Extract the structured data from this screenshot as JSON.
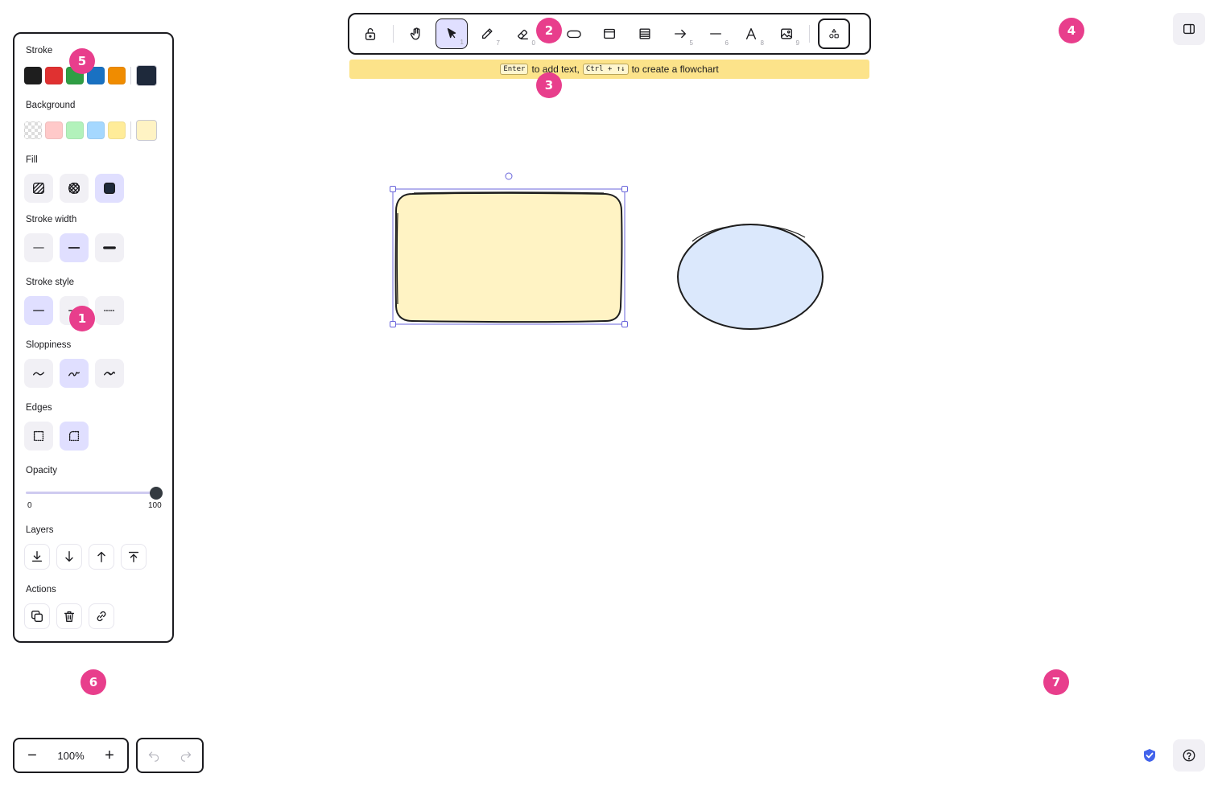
{
  "toolbar": {
    "tools": [
      {
        "name": "lock",
        "key": ""
      },
      {
        "name": "hand",
        "key": ""
      },
      {
        "name": "selection",
        "key": "1"
      },
      {
        "name": "draw",
        "key": "7"
      },
      {
        "name": "eraser",
        "key": "0"
      },
      {
        "name": "rectangle",
        "key": ""
      },
      {
        "name": "frame",
        "key": ""
      },
      {
        "name": "table",
        "key": ""
      },
      {
        "name": "arrow",
        "key": "5"
      },
      {
        "name": "line",
        "key": "6"
      },
      {
        "name": "text",
        "key": "8"
      },
      {
        "name": "image",
        "key": "9"
      },
      {
        "name": "more-shapes",
        "key": ""
      }
    ],
    "active_tool": "selection"
  },
  "hint": {
    "key1": "Enter",
    "text1": "to add text,",
    "key2": "Ctrl + ↑↓",
    "text2": "to create a flowchart"
  },
  "panel": {
    "stroke_label": "Stroke",
    "stroke_colors": [
      "#1e1e1e",
      "#e03131",
      "#2f9e44",
      "#1971c2",
      "#f08c00"
    ],
    "stroke_current": "#1e293b",
    "background_label": "Background",
    "background_colors": [
      "transparent",
      "#ffc9c9",
      "#b2f2bb",
      "#a5d8ff",
      "#ffec99"
    ],
    "background_current": "#fff3c4",
    "fill_label": "Fill",
    "stroke_width_label": "Stroke width",
    "stroke_style_label": "Stroke style",
    "sloppiness_label": "Sloppiness",
    "edges_label": "Edges",
    "opacity_label": "Opacity",
    "opacity_min": "0",
    "opacity_max": "100",
    "opacity_value": 100,
    "layers_label": "Layers",
    "actions_label": "Actions"
  },
  "zoom": {
    "value": "100%"
  },
  "canvas": {
    "rectangle": {
      "fill": "#fff3c4",
      "stroke": "#1e1e1e",
      "selected": true
    },
    "ellipse": {
      "fill": "#dbe8fc",
      "stroke": "#1e1e1e"
    },
    "selection_color": "#6965db"
  },
  "badges": [
    "1",
    "2",
    "3",
    "4",
    "5",
    "6",
    "7"
  ]
}
